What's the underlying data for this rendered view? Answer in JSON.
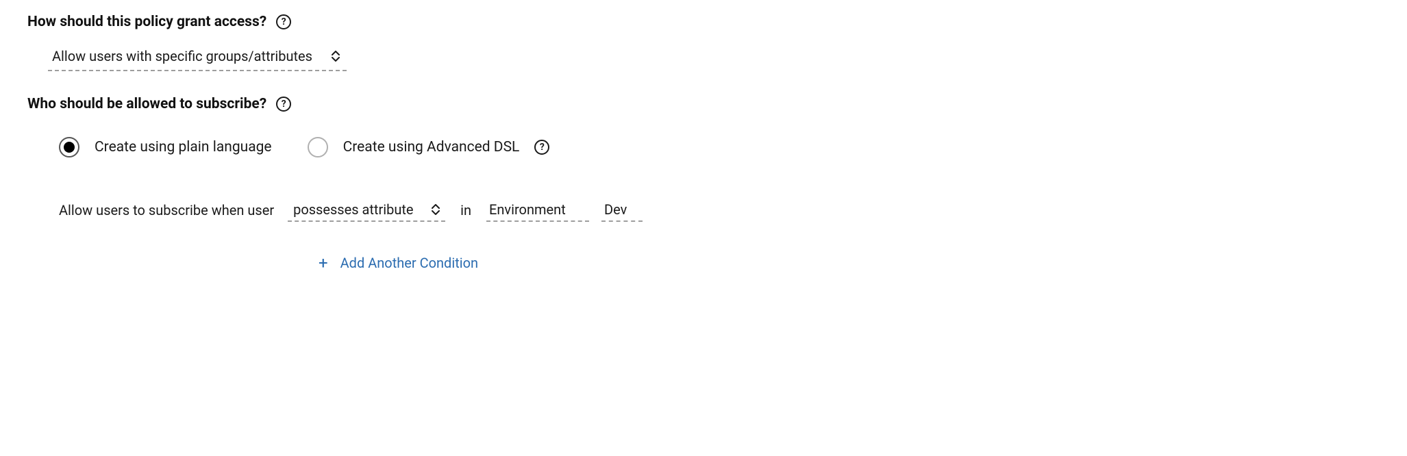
{
  "section1": {
    "heading": "How should this policy grant access?",
    "select_value": "Allow users with specific groups/attributes"
  },
  "section2": {
    "heading": "Who should be allowed to subscribe?",
    "radio_options": {
      "plain": "Create using plain language",
      "dsl": "Create using Advanced DSL"
    },
    "condition": {
      "prefix": "Allow users to subscribe when user",
      "predicate": "possesses attribute",
      "joiner": "in",
      "attribute_key": "Environment",
      "attribute_value": "Dev"
    },
    "add_condition_label": "Add Another Condition"
  }
}
